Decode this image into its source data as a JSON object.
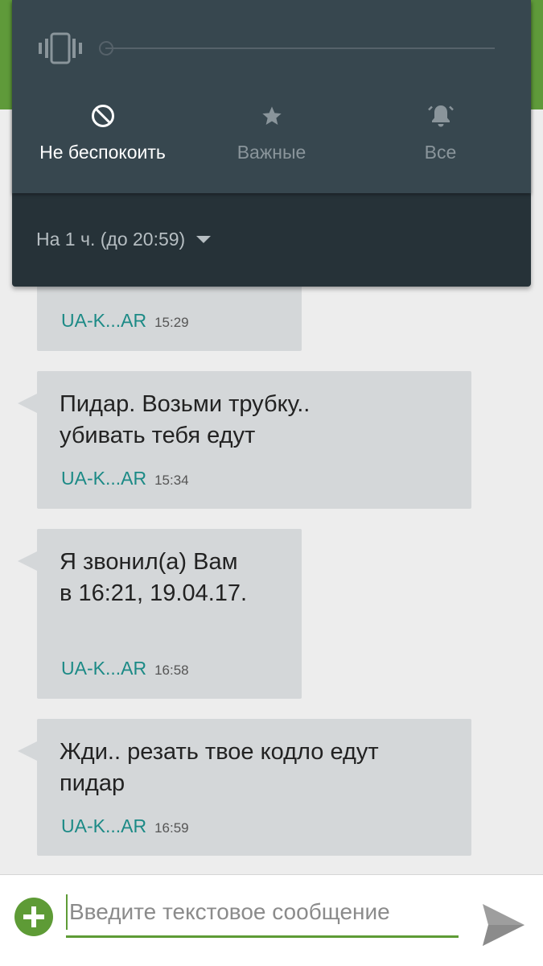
{
  "notification_shade": {
    "modes": [
      {
        "label": "Не беспокоить",
        "icon": "do-not-disturb-icon",
        "active": true
      },
      {
        "label": "Важные",
        "icon": "star-icon",
        "active": false
      },
      {
        "label": "Все",
        "icon": "bell-icon",
        "active": false
      }
    ],
    "duration_label": "На 1 ч. (до 20:59)"
  },
  "messages": [
    {
      "text": "",
      "sender": "UA-K...AR",
      "time": "15:29"
    },
    {
      "text": "Пидар. Возьми трубку..\nубивать тебя едут",
      "sender": "UA-K...AR",
      "time": "15:34"
    },
    {
      "text": "Я звонил(а) Вам\nв 16:21, 19.04.17.",
      "sender": "UA-K...AR",
      "time": "16:58"
    },
    {
      "text": "Жди.. резать твое кодло едут\nпидар",
      "sender": "UA-K...AR",
      "time": "16:59"
    }
  ],
  "compose": {
    "placeholder": "Введите текстовое сообщение"
  },
  "colors": {
    "accent": "#5e9b36",
    "sender": "#1c8a86",
    "bubble": "#d4d7d9",
    "shade": "#263238"
  }
}
